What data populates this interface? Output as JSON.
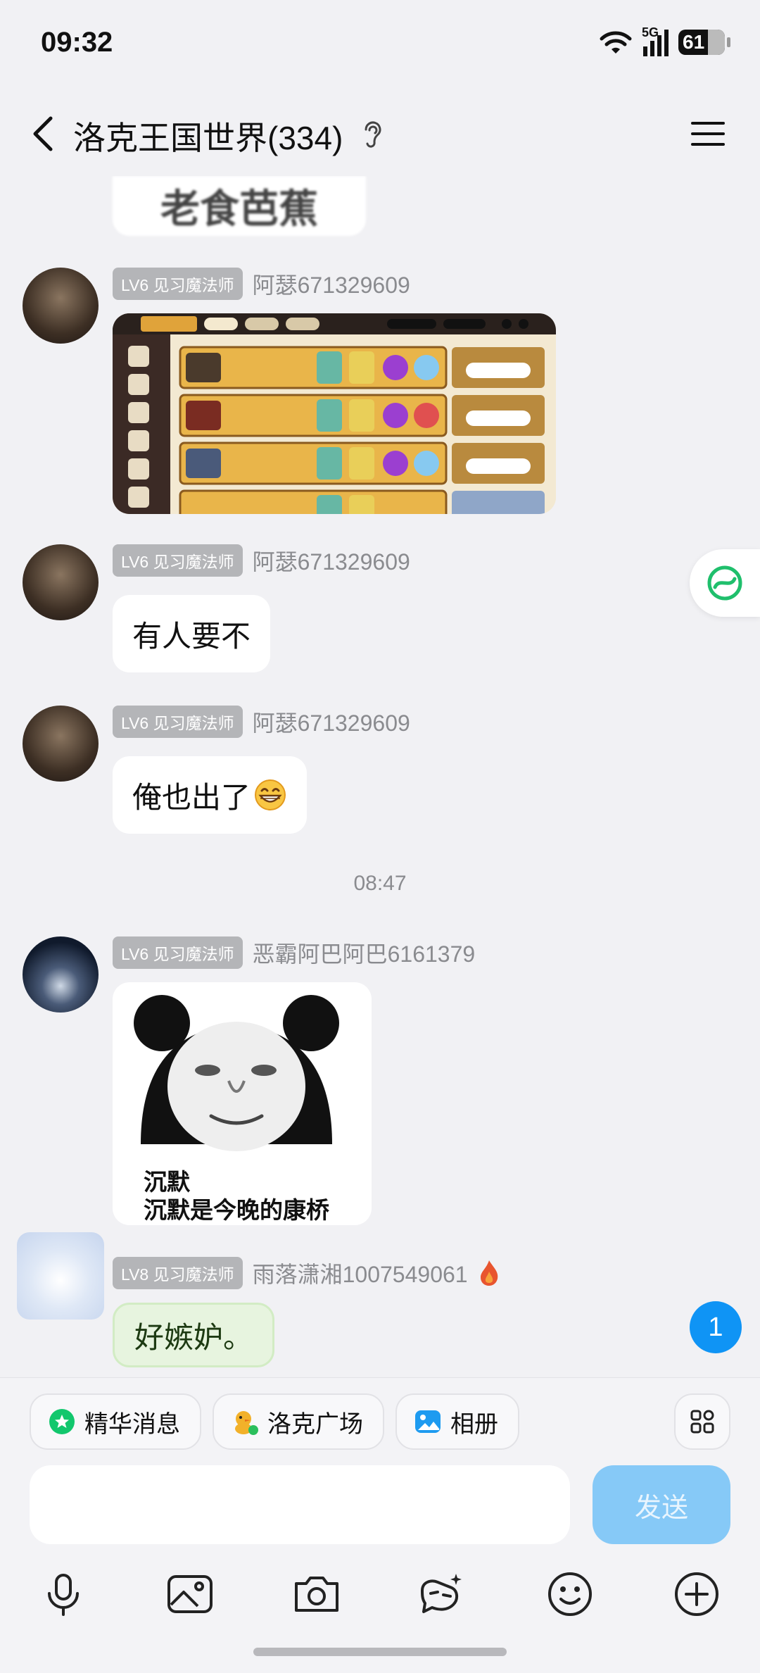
{
  "status": {
    "time": "09:32",
    "network": "5G",
    "battery": "61"
  },
  "header": {
    "title": "洛克王国世界(334)"
  },
  "chat": {
    "previous_image_text": "老食芭蕉",
    "messages": [
      {
        "badge": "LV6 见习魔法师",
        "nick": "阿瑟671329609",
        "type": "image"
      },
      {
        "badge": "LV6 见习魔法师",
        "nick": "阿瑟671329609",
        "text": "有人要不"
      },
      {
        "badge": "LV6 见习魔法师",
        "nick": "阿瑟671329609",
        "text": "俺也出了"
      },
      {
        "badge": "LV6 见习魔法师",
        "nick": "恶霸阿巴阿巴6161379",
        "type": "sticker",
        "caption_line1": "沉默",
        "caption_line2": "沉默是今晚的康桥"
      },
      {
        "badge": "LV8 见习魔法师",
        "nick": "雨落潇湘1007549061",
        "text": "好嫉妒。"
      }
    ],
    "time_divider": "08:47",
    "unread_count": "1"
  },
  "bottom": {
    "chips": [
      {
        "label": "精华消息",
        "icon": "star-icon"
      },
      {
        "label": "洛克广场",
        "icon": "duck-avatar-icon"
      },
      {
        "label": "相册",
        "icon": "album-icon"
      }
    ],
    "send_label": "发送"
  }
}
